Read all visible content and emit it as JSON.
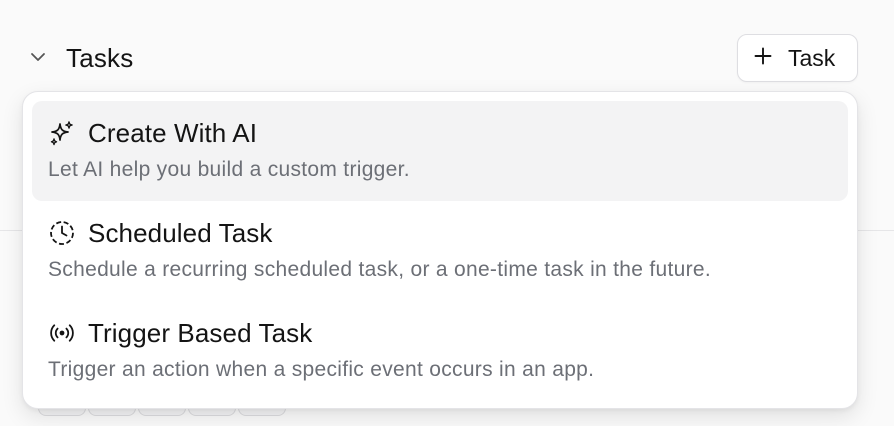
{
  "section": {
    "title": "Tasks",
    "toggle_icon": "chevron-down-icon"
  },
  "add_button": {
    "icon": "plus-icon",
    "label": "Task"
  },
  "menu": {
    "items": [
      {
        "icon": "sparkles-icon",
        "title": "Create With AI",
        "description": "Let AI help you build a custom trigger.",
        "highlighted": true
      },
      {
        "icon": "clock-icon",
        "title": "Scheduled Task",
        "description": "Schedule a recurring scheduled task, or a one-time task in the future.",
        "highlighted": false
      },
      {
        "icon": "broadcast-icon",
        "title": "Trigger Based Task",
        "description": "Trigger an action when a specific event occurs in an app.",
        "highlighted": false
      }
    ]
  },
  "colors": {
    "background": "#fafafa",
    "menu_background": "#ffffff",
    "highlight": "#f3f3f4",
    "title_text": "#141414",
    "muted_text": "#6c6f76",
    "border": "#e4e4e7"
  }
}
